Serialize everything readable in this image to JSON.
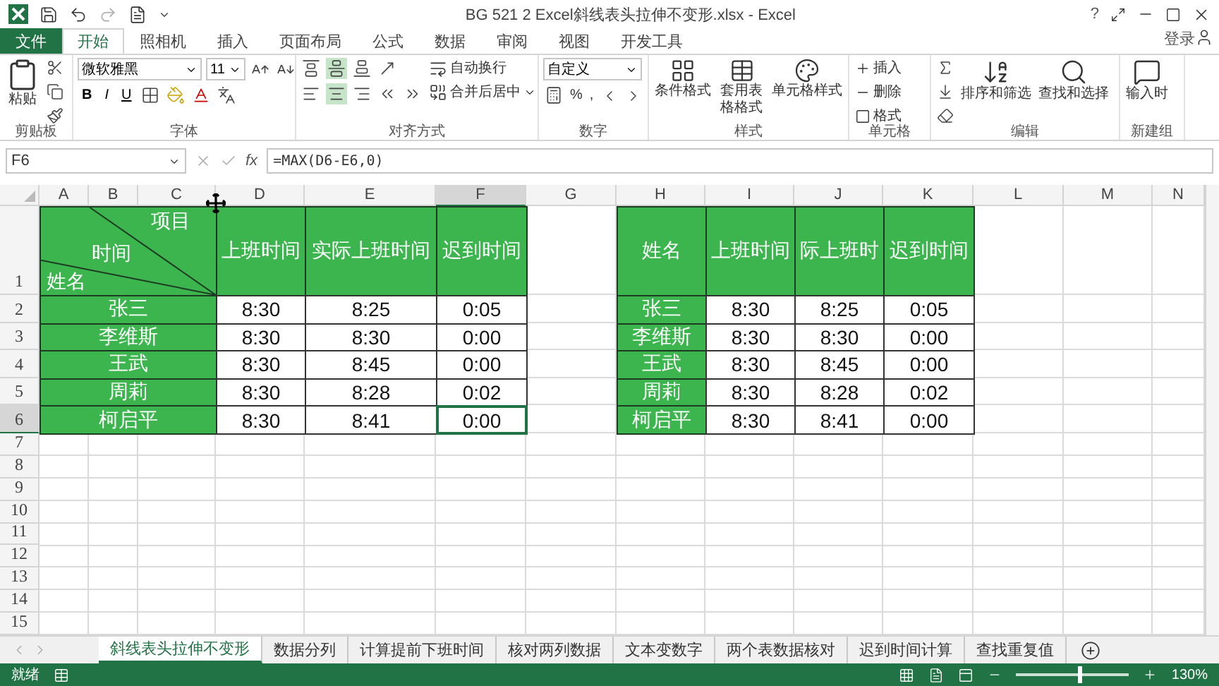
{
  "title_bar": {
    "title": "BG 521 2 Excel斜线表头拉伸不变形.xlsx - Excel",
    "help": "?"
  },
  "ribbon_tabs": [
    {
      "label": "文件",
      "kind": "file",
      "selected": false
    },
    {
      "label": "开始",
      "kind": "tab",
      "selected": true
    },
    {
      "label": "照相机",
      "kind": "tab",
      "selected": false
    },
    {
      "label": "插入",
      "kind": "tab",
      "selected": false
    },
    {
      "label": "页面布局",
      "kind": "tab",
      "selected": false
    },
    {
      "label": "公式",
      "kind": "tab",
      "selected": false
    },
    {
      "label": "数据",
      "kind": "tab",
      "selected": false
    },
    {
      "label": "审阅",
      "kind": "tab",
      "selected": false
    },
    {
      "label": "视图",
      "kind": "tab",
      "selected": false
    },
    {
      "label": "开发工具",
      "kind": "tab",
      "selected": false
    }
  ],
  "sign_in": "登录",
  "ribbon": {
    "clipboard": {
      "paste": "粘贴",
      "label": "剪贴板"
    },
    "font": {
      "name": "微软雅黑",
      "size": "11",
      "bold": "B",
      "italic": "I",
      "underline": "U",
      "label": "字体"
    },
    "alignment": {
      "vertical": [
        {
          "selected": false
        },
        {
          "selected": true
        },
        {
          "selected": false
        }
      ],
      "horizontal": [
        {
          "selected": false
        },
        {
          "selected": true
        },
        {
          "selected": false
        }
      ],
      "wrap": "自动换行",
      "merge": "合并后居中",
      "label": "对齐方式"
    },
    "number": {
      "format": "自定义",
      "percent": "%",
      "comma": ",",
      "label": "数字"
    },
    "styles": {
      "buttons": [
        "条件格式",
        "套用表格格式",
        "单元格样式"
      ],
      "label": "样式"
    },
    "cells": {
      "buttons": [
        "插入",
        "删除",
        "格式"
      ],
      "label": "单元格"
    },
    "editing": {
      "buttons": [
        "排序和筛选",
        "查找和选择"
      ],
      "label": "编辑"
    },
    "new_group": {
      "buttons": [
        "输入时"
      ],
      "label": "新建组"
    }
  },
  "formula_bar": {
    "name_box": "F6",
    "function_label": "fx",
    "formula": "=MAX(D6-E6,0)"
  },
  "sheet": {
    "columns": [
      {
        "label": "A",
        "selected": false
      },
      {
        "label": "B",
        "selected": false
      },
      {
        "label": "C",
        "selected": false
      },
      {
        "label": "D",
        "selected": false
      },
      {
        "label": "E",
        "selected": false
      },
      {
        "label": "F",
        "selected": true
      },
      {
        "label": "G",
        "selected": false
      },
      {
        "label": "H",
        "selected": false
      },
      {
        "label": "I",
        "selected": false
      },
      {
        "label": "J",
        "selected": false
      },
      {
        "label": "K",
        "selected": false
      },
      {
        "label": "L",
        "selected": false
      },
      {
        "label": "M",
        "selected": false
      },
      {
        "label": "N",
        "selected": false
      }
    ],
    "rows": [
      {
        "label": "1",
        "selected": false
      },
      {
        "label": "2",
        "selected": false
      },
      {
        "label": "3",
        "selected": false
      },
      {
        "label": "4",
        "selected": false
      },
      {
        "label": "5",
        "selected": false
      },
      {
        "label": "6",
        "selected": true
      },
      {
        "label": "7",
        "selected": false
      },
      {
        "label": "8",
        "selected": false
      },
      {
        "label": "9",
        "selected": false
      },
      {
        "label": "10",
        "selected": false
      },
      {
        "label": "11",
        "selected": false
      },
      {
        "label": "12",
        "selected": false
      },
      {
        "label": "13",
        "selected": false
      },
      {
        "label": "14",
        "selected": false
      },
      {
        "label": "15",
        "selected": false
      }
    ]
  },
  "table1": {
    "corner": {
      "top": "项目",
      "middle": "时间",
      "bottom": "姓名"
    },
    "headers": [
      "上班时间",
      "实际上班时间",
      "迟到时间"
    ],
    "rows": [
      {
        "name": "张三",
        "start": "8:30",
        "actual": "8:25",
        "late": "0:05",
        "late_active": false
      },
      {
        "name": "李维斯",
        "start": "8:30",
        "actual": "8:30",
        "late": "0:00",
        "late_active": false
      },
      {
        "name": "王武",
        "start": "8:30",
        "actual": "8:45",
        "late": "0:00",
        "late_active": false
      },
      {
        "name": "周莉",
        "start": "8:30",
        "actual": "8:28",
        "late": "0:02",
        "late_active": false
      },
      {
        "name": "柯启平",
        "start": "8:30",
        "actual": "8:41",
        "late": "0:00",
        "late_active": true
      }
    ]
  },
  "table2": {
    "headers": [
      "姓名",
      "上班时间",
      "际上班时",
      "迟到时间"
    ],
    "rows": [
      {
        "name": "张三",
        "start": "8:30",
        "actual": "8:25",
        "late": "0:05"
      },
      {
        "name": "李维斯",
        "start": "8:30",
        "actual": "8:30",
        "late": "0:00"
      },
      {
        "name": "王武",
        "start": "8:30",
        "actual": "8:45",
        "late": "0:00"
      },
      {
        "name": "周莉",
        "start": "8:30",
        "actual": "8:28",
        "late": "0:02"
      },
      {
        "name": "柯启平",
        "start": "8:30",
        "actual": "8:41",
        "late": "0:00"
      }
    ]
  },
  "sheet_tabs": [
    {
      "label": "斜线表头拉伸不变形",
      "selected": true
    },
    {
      "label": "数据分列",
      "selected": false
    },
    {
      "label": "计算提前下班时间",
      "selected": false
    },
    {
      "label": "核对两列数据",
      "selected": false
    },
    {
      "label": "文本变数字",
      "selected": false
    },
    {
      "label": "两个表数据核对",
      "selected": false
    },
    {
      "label": "迟到时间计算",
      "selected": false
    },
    {
      "label": "查找重复值",
      "selected": false
    }
  ],
  "status_bar": {
    "status": "就绪",
    "zoom": "130%",
    "zoom_slider": {
      "level": 0.56
    }
  }
}
